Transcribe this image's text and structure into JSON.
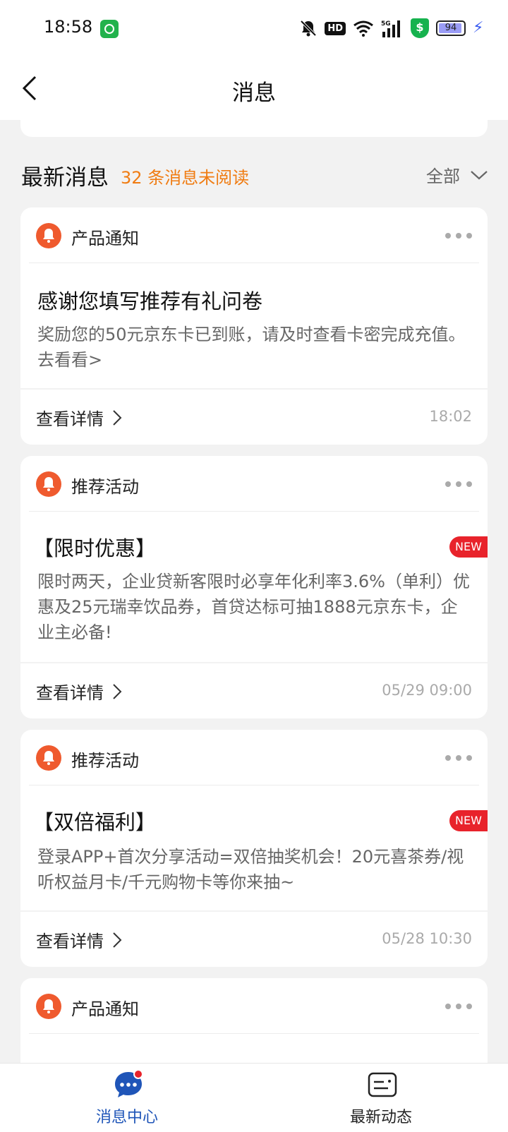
{
  "status_bar": {
    "time": "18:58",
    "battery": "94",
    "icons": [
      "app-notify-icon",
      "mute-icon",
      "hd-icon",
      "wifi-icon",
      "5g-signal-icon",
      "shield-icon",
      "battery-icon",
      "charging-icon"
    ]
  },
  "header": {
    "title": "消息",
    "back_icon": "chevron-left-icon"
  },
  "section": {
    "title": "最新消息",
    "unread_text": "32 条消息未阅读",
    "filter_label": "全部",
    "accent_color": "#f07c12"
  },
  "messages": [
    {
      "category": "产品通知",
      "title": "感谢您填写推荐有礼问卷",
      "body": "奖励您的50元京东卡已到账，请及时查看卡密完成充值。去看看>",
      "is_new": false,
      "detail_label": "查看详情",
      "time": "18:02"
    },
    {
      "category": "推荐活动",
      "title": "【限时优惠】",
      "body": "限时两天，企业贷新客限时必享年化利率3.6%（单利）优惠及25元瑞幸饮品券，首贷达标可抽1888元京东卡，企业主必备!",
      "is_new": true,
      "new_label": "NEW",
      "detail_label": "查看详情",
      "time": "05/29 09:00"
    },
    {
      "category": "推荐活动",
      "title": "【双倍福利】",
      "body": "登录APP+首次分享活动=双倍抽奖机会！20元喜茶券/视听权益月卡/千元购物卡等你来抽~",
      "is_new": true,
      "new_label": "NEW",
      "detail_label": "查看详情",
      "time": "05/28 10:30"
    },
    {
      "category": "产品通知"
    }
  ],
  "bottom_nav": {
    "items": [
      {
        "label": "消息中心",
        "icon": "message-center-icon",
        "active": true
      },
      {
        "label": "最新动态",
        "icon": "news-icon",
        "active": false
      }
    ]
  },
  "colors": {
    "bell": "#ef5a2e",
    "new_badge": "#e8232b",
    "nav_active": "#1f55b8"
  }
}
